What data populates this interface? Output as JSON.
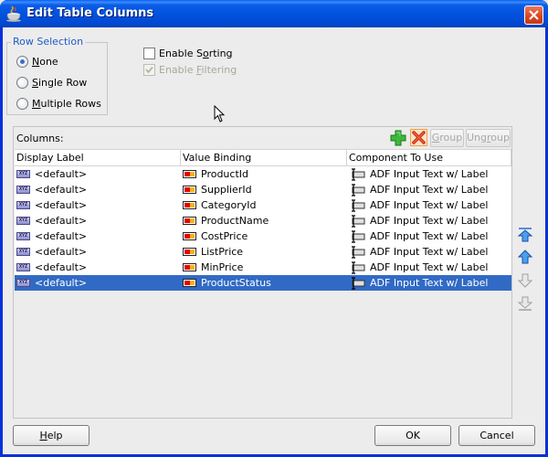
{
  "window": {
    "title": "Edit Table Columns",
    "icon": "java-cup-icon",
    "close_icon": "close-icon"
  },
  "row_selection": {
    "legend": "Row Selection",
    "selected": "None",
    "options": [
      {
        "pre": "",
        "mnemonic": "N",
        "post": "one",
        "checked": true
      },
      {
        "pre": "",
        "mnemonic": "S",
        "post": "ingle Row",
        "checked": false
      },
      {
        "pre": "",
        "mnemonic": "M",
        "post": "ultiple Rows",
        "checked": false
      }
    ]
  },
  "options": {
    "sorting": {
      "pre": "Enable S",
      "mnemonic": "o",
      "post": "rting",
      "checked": false,
      "enabled": true
    },
    "filtering": {
      "pre": "Enable ",
      "mnemonic": "F",
      "post": "iltering",
      "checked": true,
      "enabled": false
    }
  },
  "columns": {
    "label": "Columns:",
    "toolbar": {
      "add_icon": "add-icon",
      "delete_icon": "delete-icon",
      "group": {
        "pre": "",
        "mnemonic": "G",
        "post": "roup",
        "enabled": false
      },
      "ungroup": {
        "pre": "Ung",
        "mnemonic": "r",
        "post": "oup",
        "enabled": false
      }
    },
    "headers": [
      "Display Label",
      "Value Binding",
      "Component To Use"
    ],
    "rows": [
      {
        "display_label": "<default>",
        "value_binding": "ProductId",
        "component": "ADF Input Text w/ Label",
        "selected": false
      },
      {
        "display_label": "<default>",
        "value_binding": "SupplierId",
        "component": "ADF Input Text w/ Label",
        "selected": false
      },
      {
        "display_label": "<default>",
        "value_binding": "CategoryId",
        "component": "ADF Input Text w/ Label",
        "selected": false
      },
      {
        "display_label": "<default>",
        "value_binding": "ProductName",
        "component": "ADF Input Text w/ Label",
        "selected": false
      },
      {
        "display_label": "<default>",
        "value_binding": "CostPrice",
        "component": "ADF Input Text w/ Label",
        "selected": false
      },
      {
        "display_label": "<default>",
        "value_binding": "ListPrice",
        "component": "ADF Input Text w/ Label",
        "selected": false
      },
      {
        "display_label": "<default>",
        "value_binding": "MinPrice",
        "component": "ADF Input Text w/ Label",
        "selected": false
      },
      {
        "display_label": "<default>",
        "value_binding": "ProductStatus",
        "component": "ADF Input Text w/ Label",
        "selected": true
      }
    ],
    "reorder": [
      {
        "name": "move-to-top-icon",
        "enabled": true
      },
      {
        "name": "move-up-icon",
        "enabled": true
      },
      {
        "name": "move-down-icon",
        "enabled": false
      },
      {
        "name": "move-to-bottom-icon",
        "enabled": false
      }
    ]
  },
  "footer": {
    "help": {
      "pre": "",
      "mnemonic": "H",
      "post": "elp"
    },
    "ok": "OK",
    "cancel": "Cancel"
  },
  "colors": {
    "selection": "#316ac5",
    "titlebar": "#0253e0",
    "legend": "#1e5bc6"
  }
}
